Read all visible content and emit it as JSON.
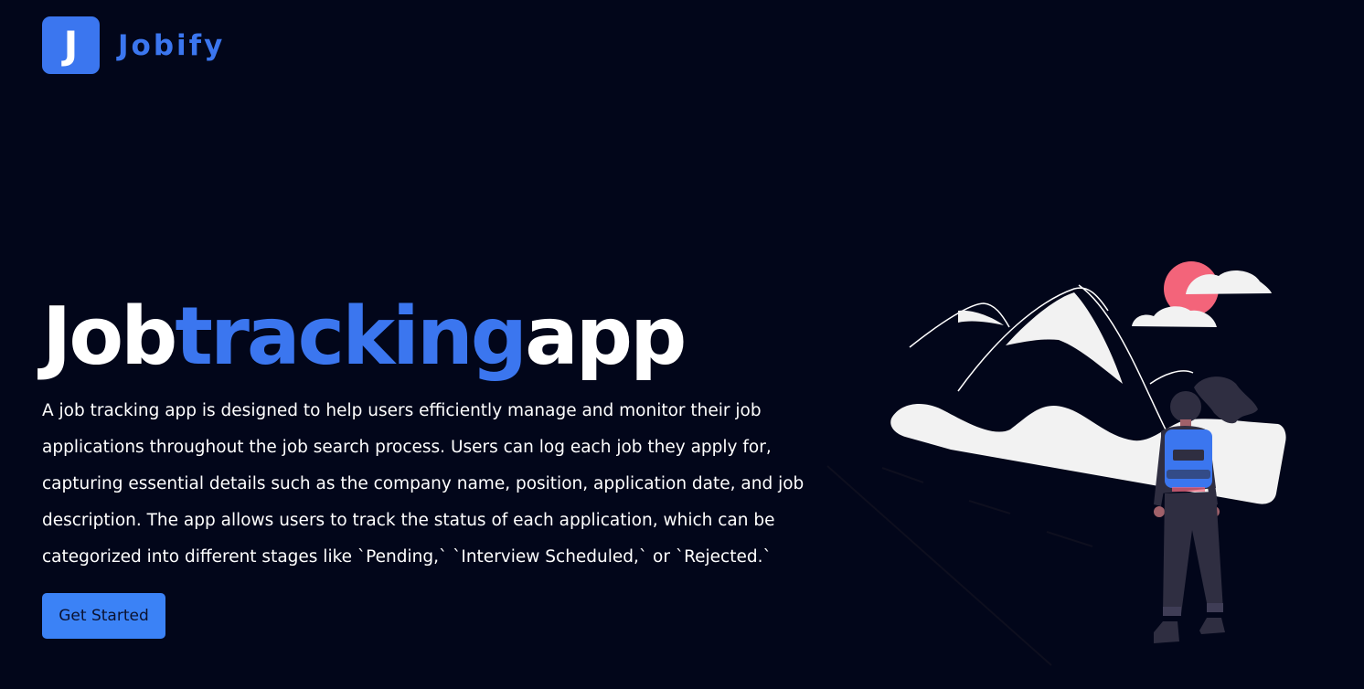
{
  "brand": {
    "logo_letter": "J",
    "name": "Jobify",
    "accent_color": "#3b76ef"
  },
  "hero": {
    "title_word_1": "Job",
    "title_word_2": "tracking",
    "title_word_3": "app",
    "description": "A job tracking app is designed to help users efficiently manage and monitor their job applications throughout the job search process. Users can log each job they apply for, capturing essential details such as the company name, position, application date, and job description. The app allows users to track the status of each application, which can be categorized into different stages like `Pending,` `Interview Scheduled,` or `Rejected.`",
    "cta_label": "Get Started"
  },
  "illustration": {
    "icon": "woman-looking-at-mountains-illustration",
    "sun_color": "#f3647a",
    "backpack_color": "#3b76ef"
  },
  "colors": {
    "background": "#02061a",
    "text": "#ffffff",
    "button": "#3b82f6"
  }
}
